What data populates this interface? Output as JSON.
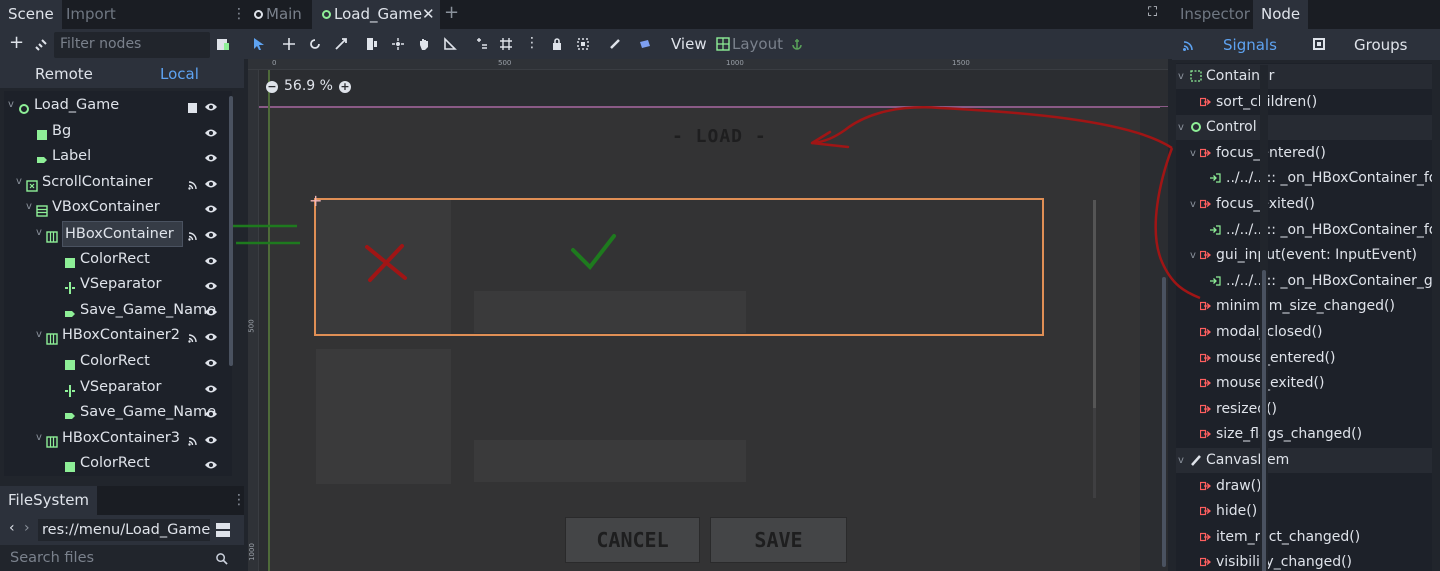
{
  "scene_dock": {
    "tabs": [
      "Scene",
      "Import"
    ],
    "filter_placeholder": "Filter nodes",
    "remote_label": "Remote",
    "local_label": "Local",
    "tree": [
      {
        "label": "Load_Game",
        "icon": "control-circle-icon"
      },
      {
        "label": "Bg",
        "icon": "color-rect-icon"
      },
      {
        "label": "Label",
        "icon": "label-icon"
      },
      {
        "label": "ScrollContainer",
        "icon": "scroll-container-icon"
      },
      {
        "label": "VBoxContainer",
        "icon": "vbox-icon"
      },
      {
        "label": "HBoxContainer",
        "icon": "hbox-icon"
      },
      {
        "label": "ColorRect",
        "icon": "color-rect-icon"
      },
      {
        "label": "VSeparator",
        "icon": "vseparator-icon"
      },
      {
        "label": "Save_Game_Name",
        "icon": "label-icon"
      },
      {
        "label": "HBoxContainer2",
        "icon": "hbox-icon"
      },
      {
        "label": "ColorRect",
        "icon": "color-rect-icon"
      },
      {
        "label": "VSeparator",
        "icon": "vseparator-icon"
      },
      {
        "label": "Save_Game_Name",
        "icon": "label-icon"
      },
      {
        "label": "HBoxContainer3",
        "icon": "hbox-icon"
      },
      {
        "label": "ColorRect",
        "icon": "color-rect-icon"
      }
    ]
  },
  "filesystem": {
    "tab": "FileSystem",
    "path": "res://menu/Load_Game.",
    "search_placeholder": "Search files"
  },
  "editor_tabs": {
    "tabs": [
      "Main",
      "Load_Game"
    ]
  },
  "toolbar": {
    "view_label": "View",
    "layout_label": "Layout"
  },
  "viewport": {
    "zoom": "56.9 %",
    "ruler_top": [
      "0",
      "500",
      "1000",
      "1500"
    ],
    "ruler_left": [
      "500",
      "1000"
    ],
    "game_title": "- LOAD -",
    "cancel_label": "CANCEL",
    "save_label": "SAVE"
  },
  "inspector": {
    "tabs": [
      "Inspector",
      "Node"
    ],
    "signals_label": "Signals",
    "groups_label": "Groups",
    "signals": [
      {
        "label": "Container",
        "kind": "category"
      },
      {
        "label": "sort_children()",
        "kind": "signal"
      },
      {
        "label": "Control",
        "kind": "category"
      },
      {
        "label": "focus_entered()",
        "kind": "signal"
      },
      {
        "label": "../../.. :: _on_HBoxContainer_fo",
        "kind": "connection"
      },
      {
        "label": "focus_exited()",
        "kind": "signal"
      },
      {
        "label": "../../.. :: _on_HBoxContainer_fo",
        "kind": "connection"
      },
      {
        "label": "gui_input(event: InputEvent)",
        "kind": "signal"
      },
      {
        "label": "../../.. :: _on_HBoxContainer_g",
        "kind": "connection"
      },
      {
        "label": "minimum_size_changed()",
        "kind": "signal"
      },
      {
        "label": "modal_closed()",
        "kind": "signal"
      },
      {
        "label": "mouse_entered()",
        "kind": "signal"
      },
      {
        "label": "mouse_exited()",
        "kind": "signal"
      },
      {
        "label": "resized()",
        "kind": "signal"
      },
      {
        "label": "size_flags_changed()",
        "kind": "signal"
      },
      {
        "label": "CanvasItem",
        "kind": "category"
      },
      {
        "label": "draw()",
        "kind": "signal"
      },
      {
        "label": "hide()",
        "kind": "signal"
      },
      {
        "label": "item_rect_changed()",
        "kind": "signal"
      },
      {
        "label": "visibility_changed()",
        "kind": "signal"
      }
    ]
  },
  "colors": {
    "accent_blue": "#5ea3f2",
    "node_green": "#8eef97",
    "signal_red": "#ff5f5f",
    "selection_orange": "#e08f55",
    "annotation_red": "#a01515",
    "annotation_green": "#1e7a1e"
  }
}
